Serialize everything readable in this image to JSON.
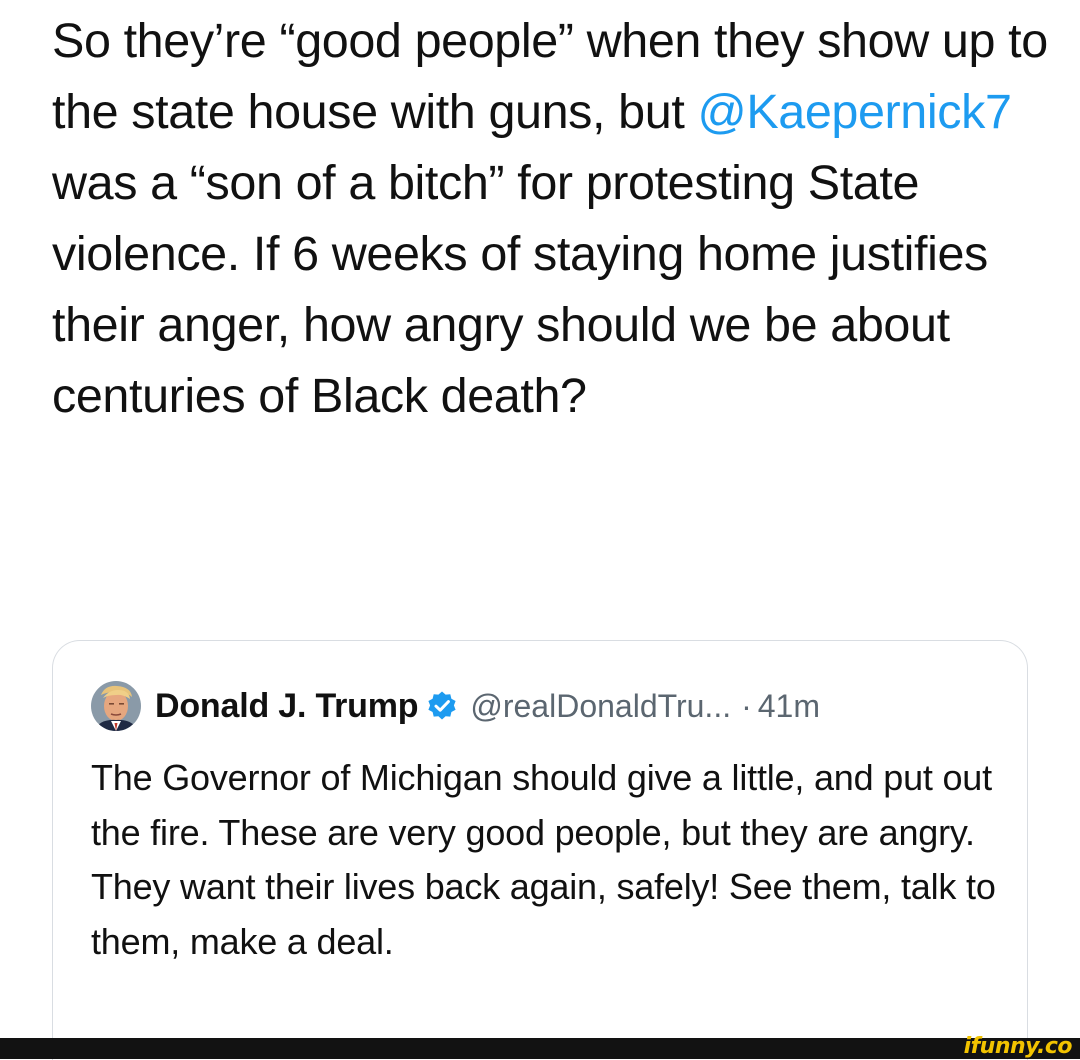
{
  "tweet": {
    "text_before_mention": "So they’re “good people” when they show up to the state house with guns, but ",
    "mention": "@Kaepernick7",
    "text_after_mention": " was a “son of a bitch” for protesting State violence. If 6 weeks of staying home justifies their anger, how angry should we be about centuries of Black death?"
  },
  "quoted_tweet": {
    "author_name": "Donald J. Trump",
    "verified_icon": "verified-badge-icon",
    "handle": "@realDonaldTru...",
    "separator": "·",
    "timestamp": "41m",
    "avatar_icon": "profile-photo",
    "text": "The Governor of Michigan should give a little, and put out the fire. These are very good people, but they are angry. They want their lives back again, safely! See them, talk to them, make a deal."
  },
  "watermark": {
    "text": "ifunny.co"
  },
  "colors": {
    "mention": "#1d9bf0",
    "verified_badge": "#1d9bf0",
    "secondary_text": "#5b6670",
    "card_border": "#d9dde2",
    "footer_bar": "#121212",
    "watermark": "#f2c300"
  }
}
